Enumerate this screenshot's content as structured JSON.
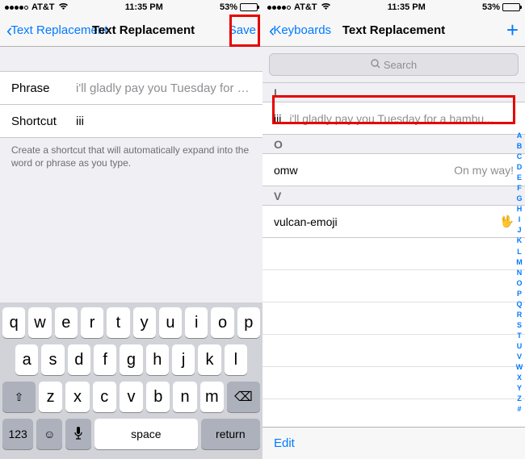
{
  "status": {
    "carrier": "AT&T",
    "time": "11:35 PM",
    "battery_pct": "53%"
  },
  "left": {
    "back_label": "Text Replacement",
    "title": "Text Replacement",
    "save_label": "Save",
    "phrase_label": "Phrase",
    "phrase_value": "i'll gladly pay you Tuesday for a ham...",
    "shortcut_label": "Shortcut",
    "shortcut_value": "iii",
    "footer": "Create a shortcut that will automatically expand into the word or phrase as you type."
  },
  "keyboard": {
    "r1": [
      "q",
      "w",
      "e",
      "r",
      "t",
      "y",
      "u",
      "i",
      "o",
      "p"
    ],
    "r2": [
      "a",
      "s",
      "d",
      "f",
      "g",
      "h",
      "j",
      "k",
      "l"
    ],
    "r3": [
      "z",
      "x",
      "c",
      "v",
      "b",
      "n",
      "m"
    ],
    "shift": "⇧",
    "backspace": "⌫",
    "numbers": "123",
    "emoji": "☺",
    "mic": "🎤",
    "space": "space",
    "return": "return"
  },
  "right": {
    "back_label": "Keyboards",
    "title": "Text Replacement",
    "search_placeholder": "Search",
    "sections": {
      "I": {
        "shortcut": "iii",
        "phrase": "i'll gladly pay you Tuesday for a hambu..."
      },
      "O": {
        "shortcut": "omw",
        "phrase": "On my way!"
      },
      "V": {
        "shortcut": "vulcan-emoji",
        "phrase": "🖖"
      }
    },
    "edit_label": "Edit",
    "index": [
      "A",
      "B",
      "C",
      "D",
      "E",
      "F",
      "G",
      "H",
      "I",
      "J",
      "K",
      "L",
      "M",
      "N",
      "O",
      "P",
      "Q",
      "R",
      "S",
      "T",
      "U",
      "V",
      "W",
      "X",
      "Y",
      "Z",
      "#"
    ]
  }
}
